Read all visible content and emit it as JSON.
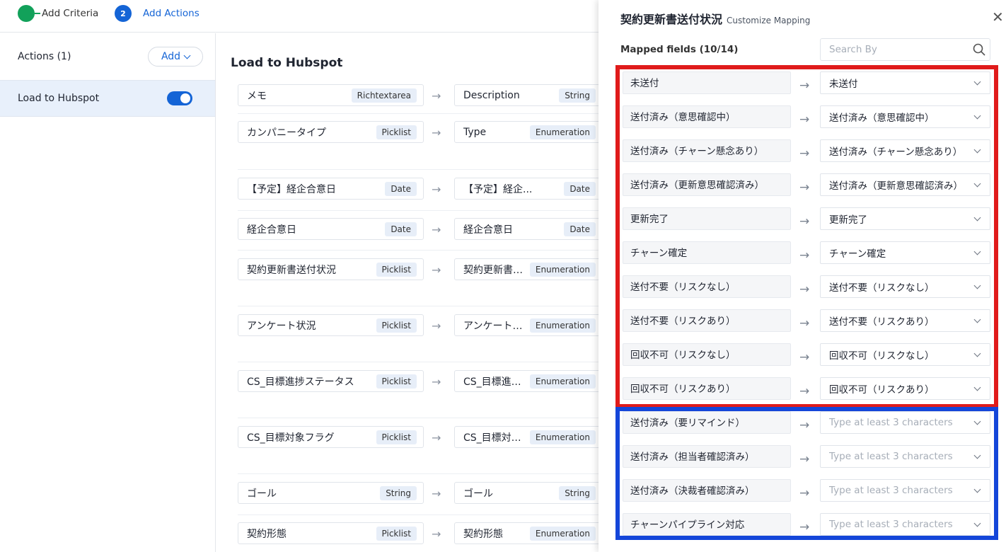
{
  "stepper": {
    "steps": [
      {
        "number": "",
        "label": "Add Criteria",
        "state": "done"
      },
      {
        "number": "2",
        "label": "Add Actions",
        "state": "active"
      }
    ]
  },
  "actions": {
    "title": "Actions (1)",
    "add_label": "Add",
    "items": [
      {
        "name": "Load to Hubspot",
        "enabled": true
      }
    ]
  },
  "main": {
    "title": "Load to Hubspot",
    "rows": [
      {
        "source": "メモ",
        "source_type": "Richtextarea",
        "target": "Description",
        "target_type": "String"
      },
      {
        "source": "カンパニータイプ",
        "source_type": "Picklist",
        "target": "Type",
        "target_type": "Enumeration"
      },
      {
        "source": "【予定】経企合意日",
        "source_type": "Date",
        "target": "【予定】経企...",
        "target_type": "Date"
      },
      {
        "source": "経企合意日",
        "source_type": "Date",
        "target": "経企合意日",
        "target_type": "Date"
      },
      {
        "source": "契約更新書送付状況",
        "source_type": "Picklist",
        "target": "契約更新書送...",
        "target_type": "Enumeration"
      },
      {
        "source": "アンケート状況",
        "source_type": "Picklist",
        "target": "アンケート状...",
        "target_type": "Enumeration"
      },
      {
        "source": "CS_目標進捗ステータス",
        "source_type": "Picklist",
        "target": "CS_目標進捗...",
        "target_type": "Enumeration"
      },
      {
        "source": "CS_目標対象フラグ",
        "source_type": "Picklist",
        "target": "CS_目標対象...",
        "target_type": "Enumeration"
      },
      {
        "source": "ゴール",
        "source_type": "String",
        "target": "ゴール",
        "target_type": "String"
      },
      {
        "source": "契約形態",
        "source_type": "Picklist",
        "target": "契約形態",
        "target_type": "Enumeration"
      }
    ]
  },
  "panel": {
    "title": "契約更新書送付状況",
    "subtitle": "Customize Mapping",
    "mapped_label": "Mapped fields (10/14)",
    "search_placeholder": "Search By",
    "mappings": [
      {
        "source": "未送付",
        "target": "未送付"
      },
      {
        "source": "送付済み（意思確認中）",
        "target": "送付済み（意思確認中）"
      },
      {
        "source": "送付済み（チャーン懸念あり）",
        "target": "送付済み（チャーン懸念あり）"
      },
      {
        "source": "送付済み（更新意思確認済み）",
        "target": "送付済み（更新意思確認済み）"
      },
      {
        "source": "更新完了",
        "target": "更新完了"
      },
      {
        "source": "チャーン確定",
        "target": "チャーン確定"
      },
      {
        "source": "送付不要（リスクなし）",
        "target": "送付不要（リスクなし）"
      },
      {
        "source": "送付不要（リスクあり）",
        "target": "送付不要（リスクあり）"
      },
      {
        "source": "回収不可（リスクなし）",
        "target": "回収不可（リスクなし）"
      },
      {
        "source": "回収不可（リスクあり）",
        "target": "回収不可（リスクあり）"
      },
      {
        "source": "送付済み（要リマインド）",
        "target": ""
      },
      {
        "source": "送付済み（担当者確認済み）",
        "target": ""
      },
      {
        "source": "送付済み（決裁者確認済み）",
        "target": ""
      },
      {
        "source": "チャーンパイプライン対応",
        "target": ""
      }
    ],
    "unmapped_placeholder": "Type at least 3 characters"
  },
  "colors": {
    "primary": "#1464d6",
    "success": "#12a15a",
    "highlight_mapped": "#e01b1b",
    "highlight_unmapped": "#1446d9"
  }
}
